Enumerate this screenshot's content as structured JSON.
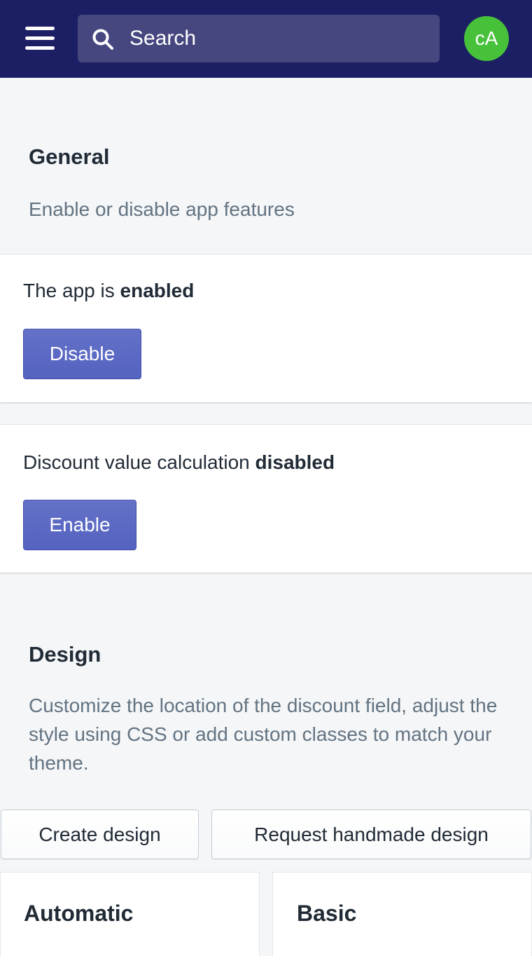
{
  "topbar": {
    "menu_icon": "hamburger-menu-icon",
    "search": {
      "icon": "search-icon",
      "placeholder": "Search",
      "value": ""
    },
    "avatar": {
      "initials": "cA",
      "color": "#47c13a"
    },
    "background": "#1c1f64"
  },
  "general": {
    "title": "General",
    "description": "Enable or disable app features",
    "app_status": {
      "prefix": "The app is ",
      "status": "enabled",
      "button_label": "Disable"
    },
    "discount_calc": {
      "prefix": "Discount value calculation ",
      "status": "disabled",
      "button_label": "Enable"
    }
  },
  "design": {
    "title": "Design",
    "description": "Customize the location of the discount field, adjust the style using CSS or add custom classes to match your theme.",
    "create_button": "Create design",
    "request_button": "Request handmade design",
    "cards": [
      {
        "title": "Automatic"
      },
      {
        "title": "Basic"
      }
    ]
  },
  "colors": {
    "primary": "#5c6ac4",
    "page_bg": "#f4f6f8",
    "text": "#212b36",
    "subdued": "#637381"
  }
}
